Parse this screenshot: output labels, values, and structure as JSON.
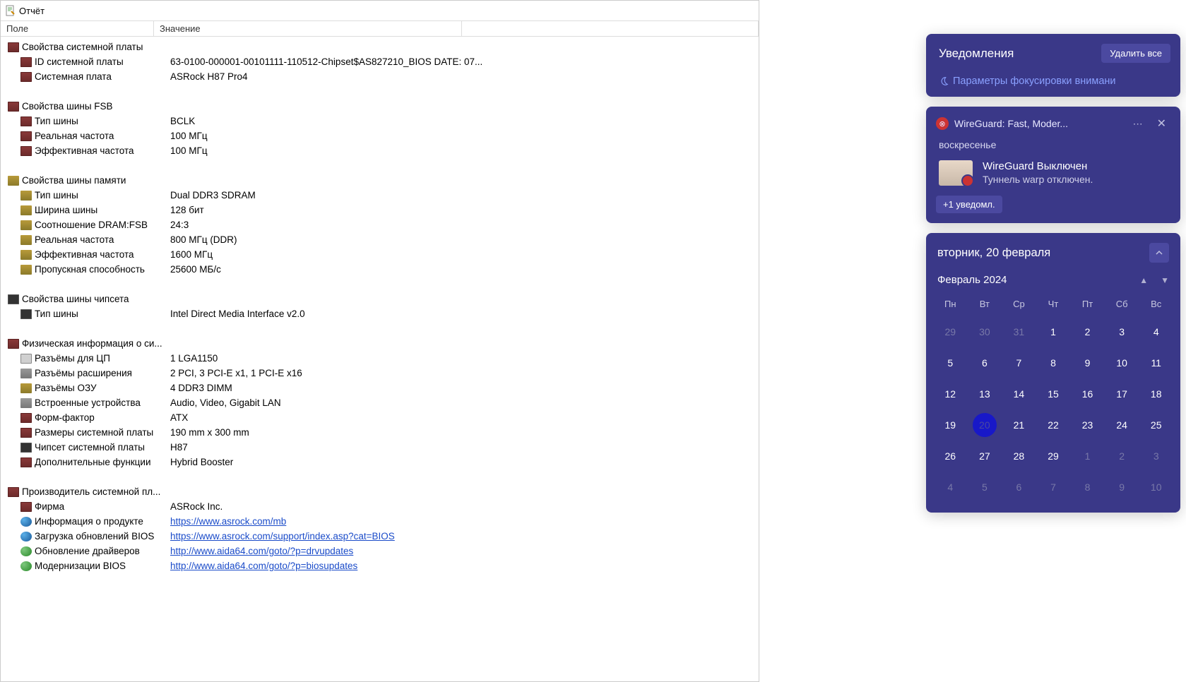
{
  "window": {
    "title": "Отчёт"
  },
  "columns": {
    "field": "Поле",
    "value": "Значение"
  },
  "report": [
    {
      "type": "group",
      "icon": "board",
      "label": "Свойства системной платы"
    },
    {
      "type": "item",
      "icon": "board",
      "label": "ID системной платы",
      "value": "63-0100-000001-00101111-110512-Chipset$AS827210_BIOS DATE: 07..."
    },
    {
      "type": "item",
      "icon": "board",
      "label": "Системная плата",
      "value": "ASRock H87 Pro4"
    },
    {
      "type": "spacer"
    },
    {
      "type": "group",
      "icon": "board",
      "label": "Свойства шины FSB"
    },
    {
      "type": "item",
      "icon": "board",
      "label": "Тип шины",
      "value": "BCLK"
    },
    {
      "type": "item",
      "icon": "board",
      "label": "Реальная частота",
      "value": "100 МГц"
    },
    {
      "type": "item",
      "icon": "board",
      "label": "Эффективная частота",
      "value": "100 МГц"
    },
    {
      "type": "spacer"
    },
    {
      "type": "group",
      "icon": "mem",
      "label": "Свойства шины памяти"
    },
    {
      "type": "item",
      "icon": "mem",
      "label": "Тип шины",
      "value": "Dual DDR3 SDRAM"
    },
    {
      "type": "item",
      "icon": "mem",
      "label": "Ширина шины",
      "value": "128 бит"
    },
    {
      "type": "item",
      "icon": "mem",
      "label": "Соотношение DRAM:FSB",
      "value": "24:3"
    },
    {
      "type": "item",
      "icon": "mem",
      "label": "Реальная частота",
      "value": "800 МГц (DDR)"
    },
    {
      "type": "item",
      "icon": "mem",
      "label": "Эффективная частота",
      "value": "1600 МГц"
    },
    {
      "type": "item",
      "icon": "mem",
      "label": "Пропускная способность",
      "value": "25600 МБ/с"
    },
    {
      "type": "spacer"
    },
    {
      "type": "group",
      "icon": "chip",
      "label": "Свойства шины чипсета"
    },
    {
      "type": "item",
      "icon": "chip",
      "label": "Тип шины",
      "value": "Intel Direct Media Interface v2.0"
    },
    {
      "type": "spacer"
    },
    {
      "type": "group",
      "icon": "board",
      "label": "Физическая информация о си..."
    },
    {
      "type": "item",
      "icon": "cpu",
      "label": "Разъёмы для ЦП",
      "value": "1 LGA1150"
    },
    {
      "type": "item",
      "icon": "slot",
      "label": "Разъёмы расширения",
      "value": "2 PCI, 3 PCI-E x1, 1 PCI-E x16"
    },
    {
      "type": "item",
      "icon": "mem",
      "label": "Разъёмы ОЗУ",
      "value": "4 DDR3 DIMM"
    },
    {
      "type": "item",
      "icon": "slot",
      "label": "Встроенные устройства",
      "value": "Audio, Video, Gigabit LAN"
    },
    {
      "type": "item",
      "icon": "board",
      "label": "Форм-фактор",
      "value": "ATX"
    },
    {
      "type": "item",
      "icon": "board",
      "label": "Размеры системной платы",
      "value": "190 mm x 300 mm"
    },
    {
      "type": "item",
      "icon": "chip",
      "label": "Чипсет системной платы",
      "value": "H87"
    },
    {
      "type": "item",
      "icon": "board",
      "label": "Дополнительные функции",
      "value": "Hybrid Booster"
    },
    {
      "type": "spacer"
    },
    {
      "type": "group",
      "icon": "board",
      "label": "Производитель системной пл..."
    },
    {
      "type": "item",
      "icon": "board",
      "label": "Фирма",
      "value": "ASRock Inc."
    },
    {
      "type": "item",
      "icon": "globe",
      "label": "Информация о продукте",
      "value": "https://www.asrock.com/mb",
      "link": true
    },
    {
      "type": "item",
      "icon": "globe",
      "label": "Загрузка обновлений BIOS",
      "value": "https://www.asrock.com/support/index.asp?cat=BIOS",
      "link": true
    },
    {
      "type": "item",
      "icon": "refresh",
      "label": "Обновление драйверов",
      "value": "http://www.aida64.com/goto/?p=drvupdates",
      "link": true
    },
    {
      "type": "item",
      "icon": "refresh",
      "label": "Модернизации BIOS",
      "value": "http://www.aida64.com/goto/?p=biosupdates",
      "link": true
    }
  ],
  "notifications": {
    "title": "Уведомления",
    "clear": "Удалить все",
    "focus": "Параметры фокусировки внимани",
    "app": "WireGuard: Fast, Moder...",
    "day": "воскресенье",
    "line1": "WireGuard Выключен",
    "line2": "Туннель warp отключен.",
    "more": "+1 уведомл."
  },
  "calendar": {
    "date": "вторник, 20 февраля",
    "month": "Февраль 2024",
    "dow": [
      "Пн",
      "Вт",
      "Ср",
      "Чт",
      "Пт",
      "Сб",
      "Вс"
    ],
    "days": [
      {
        "d": 29,
        "o": 1
      },
      {
        "d": 30,
        "o": 1
      },
      {
        "d": 31,
        "o": 1
      },
      {
        "d": 1
      },
      {
        "d": 2
      },
      {
        "d": 3
      },
      {
        "d": 4
      },
      {
        "d": 5
      },
      {
        "d": 6
      },
      {
        "d": 7
      },
      {
        "d": 8
      },
      {
        "d": 9
      },
      {
        "d": 10
      },
      {
        "d": 11
      },
      {
        "d": 12
      },
      {
        "d": 13
      },
      {
        "d": 14
      },
      {
        "d": 15
      },
      {
        "d": 16
      },
      {
        "d": 17
      },
      {
        "d": 18
      },
      {
        "d": 19
      },
      {
        "d": 20,
        "t": 1
      },
      {
        "d": 21
      },
      {
        "d": 22
      },
      {
        "d": 23
      },
      {
        "d": 24
      },
      {
        "d": 25
      },
      {
        "d": 26
      },
      {
        "d": 27
      },
      {
        "d": 28
      },
      {
        "d": 29
      },
      {
        "d": 1,
        "o": 1
      },
      {
        "d": 2,
        "o": 1
      },
      {
        "d": 3,
        "o": 1
      },
      {
        "d": 4,
        "o": 1
      },
      {
        "d": 5,
        "o": 1
      },
      {
        "d": 6,
        "o": 1
      },
      {
        "d": 7,
        "o": 1
      },
      {
        "d": 8,
        "o": 1
      },
      {
        "d": 9,
        "o": 1
      },
      {
        "d": 10,
        "o": 1
      }
    ]
  }
}
